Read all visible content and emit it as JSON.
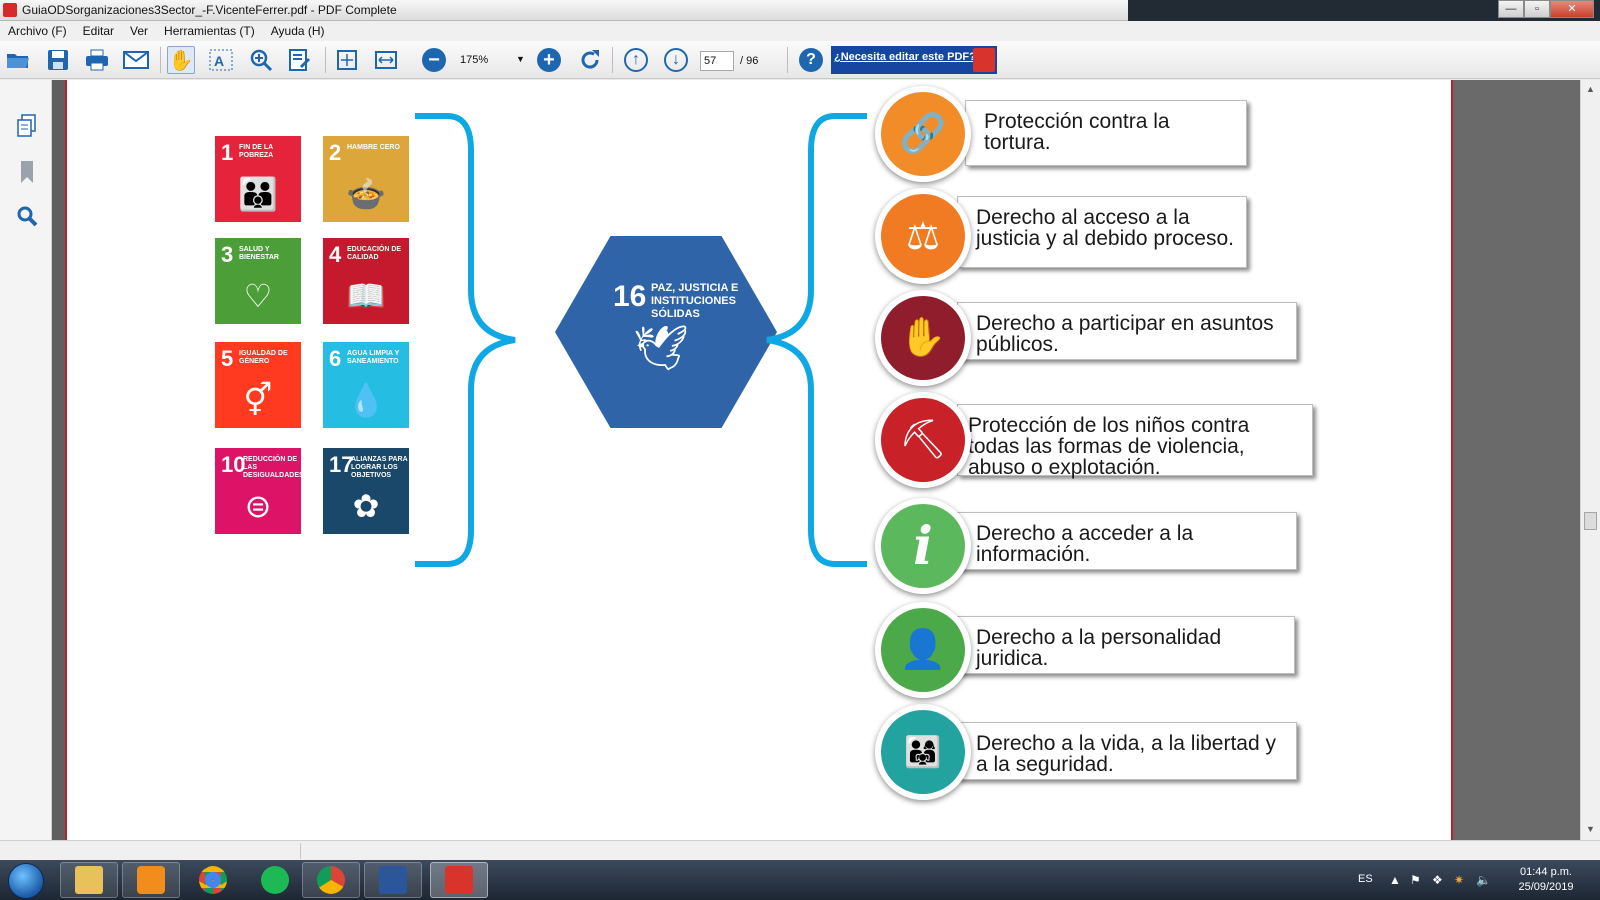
{
  "window": {
    "title": "GuiaODSorganizaciones3Sector_-F.VicenteFerrer.pdf - PDF Complete",
    "minimize": "—",
    "restore": "▫",
    "close": "✕"
  },
  "menu": [
    "Archivo (F)",
    "Editar",
    "Ver",
    "Herramientas (T)",
    "Ayuda (H)"
  ],
  "toolbar": {
    "zoom": "175%",
    "page_current": "57",
    "page_total": "/ 96",
    "ad_text": "¿Necesita editar este PDF?"
  },
  "sdg_tiles": [
    {
      "num": "1",
      "caption": "FIN DE LA POBREZA",
      "color": "#e5243b",
      "glyph": "👪"
    },
    {
      "num": "2",
      "caption": "HAMBRE CERO",
      "color": "#dda63a",
      "glyph": "🍲"
    },
    {
      "num": "3",
      "caption": "SALUD Y BIENESTAR",
      "color": "#4c9f38",
      "glyph": "♡"
    },
    {
      "num": "4",
      "caption": "EDUCACIÓN DE CALIDAD",
      "color": "#c5192d",
      "glyph": "📖"
    },
    {
      "num": "5",
      "caption": "IGUALDAD DE GÉNERO",
      "color": "#ff3a21",
      "glyph": "⚥"
    },
    {
      "num": "6",
      "caption": "AGUA LIMPIA Y SANEAMIENTO",
      "color": "#26bde2",
      "glyph": "💧"
    },
    {
      "num": "10",
      "caption": "REDUCCIÓN DE LAS DESIGUALDADES",
      "color": "#dd1367",
      "glyph": "⊜"
    },
    {
      "num": "17",
      "caption": "ALIANZAS PARA LOGRAR LOS OBJETIVOS",
      "color": "#19486a",
      "glyph": "✿"
    }
  ],
  "goal16": {
    "num": "16",
    "caption": "PAZ, JUSTICIA E INSTITUCIONES SÓLIDAS",
    "glyph": "🕊"
  },
  "rights": [
    {
      "text": "Protección contra la tortura.",
      "color": "#f28c28",
      "icon": "link-icon",
      "glyph": "🔗"
    },
    {
      "text": "Derecho al acceso a la justicia y al debido proceso.",
      "color": "#f07b22",
      "icon": "scales-icon",
      "glyph": "⚖"
    },
    {
      "text": "Derecho a participar en asuntos públicos.",
      "color": "#8f1d2c",
      "icon": "raised-hands-icon",
      "glyph": "✋"
    },
    {
      "text": "Protección de los niños contra todas las formas de violencia, abuso o explotación.",
      "color": "#c82127",
      "icon": "child-labor-icon",
      "glyph": "⛏"
    },
    {
      "text": "Derecho a acceder a la información.",
      "color": "#5cb85c",
      "icon": "info-icon",
      "glyph": "i"
    },
    {
      "text": "Derecho a la personalidad juridica.",
      "color": "#4ca94a",
      "icon": "person-icon",
      "glyph": "👤"
    },
    {
      "text": "Derecho a la vida, a la libertad y a la seguridad.",
      "color": "#22a3a0",
      "icon": "people-icon",
      "glyph": "👨‍👩‍👧"
    }
  ],
  "taskbar": {
    "language": "ES",
    "time": "01:44 p.m.",
    "date": "25/09/2019"
  }
}
